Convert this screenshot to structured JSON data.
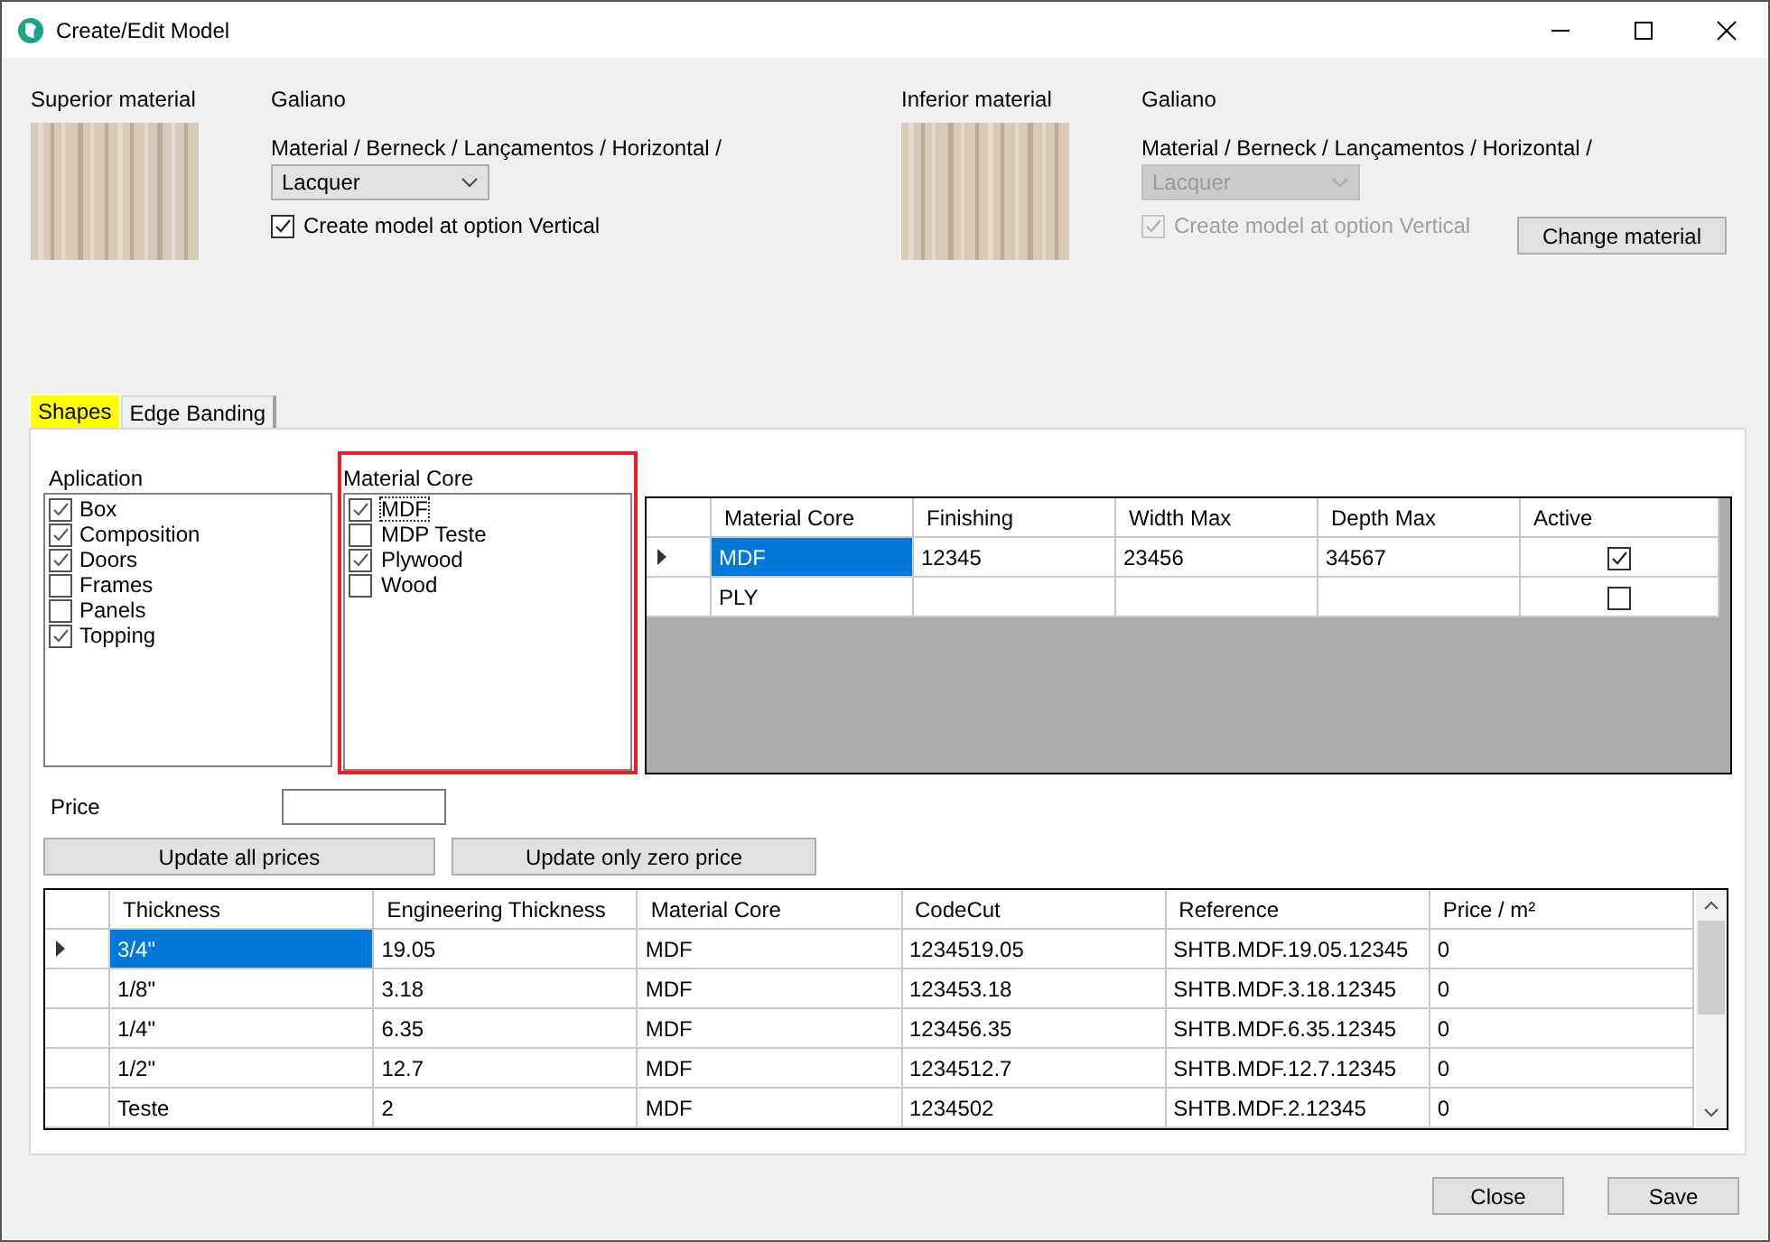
{
  "window": {
    "title": "Create/Edit Model"
  },
  "materials": [
    {
      "label": "Superior material",
      "name": "Galiano",
      "path": "Material / Berneck / Lançamentos / Horizontal /",
      "finish": {
        "value": "Lacquer",
        "disabled": false
      },
      "vertical": {
        "label": "Create model at option Vertical",
        "checked": true,
        "disabled": false
      }
    },
    {
      "label": "Inferior material",
      "name": "Galiano",
      "path": "Material / Berneck / Lançamentos / Horizontal /",
      "finish": {
        "value": "Lacquer",
        "disabled": true
      },
      "vertical": {
        "label": "Create model at option Vertical",
        "checked": true,
        "disabled": true
      }
    }
  ],
  "change_button": "Change material",
  "tabs": [
    {
      "label": "Shapes",
      "selected": true
    },
    {
      "label": "Edge Banding",
      "selected": false
    }
  ],
  "application": {
    "title": "Aplication",
    "items": [
      {
        "label": "Box",
        "checked": true
      },
      {
        "label": "Composition",
        "checked": true
      },
      {
        "label": "Doors",
        "checked": true
      },
      {
        "label": "Frames",
        "checked": false
      },
      {
        "label": "Panels",
        "checked": false
      },
      {
        "label": "Topping",
        "checked": true
      }
    ]
  },
  "material_core": {
    "title": "Material Core",
    "highlighted": true,
    "items": [
      {
        "label": "MDF",
        "checked": true,
        "focused": true
      },
      {
        "label": "MDP Teste",
        "checked": false,
        "focused": false
      },
      {
        "label": "Plywood",
        "checked": true,
        "focused": false
      },
      {
        "label": "Wood",
        "checked": false,
        "focused": false
      }
    ]
  },
  "core_grid": {
    "columns": [
      "Material Core",
      "Finishing",
      "Width Max",
      "Depth Max",
      "Active"
    ],
    "rows": [
      {
        "selected": true,
        "cells": [
          "MDF",
          "12345",
          "23456",
          "34567"
        ],
        "active": true
      },
      {
        "selected": false,
        "cells": [
          "PLY"
        ],
        "active": false
      }
    ]
  },
  "price": {
    "label": "Price"
  },
  "update_buttons": [
    "Update all prices",
    "Update only zero price"
  ],
  "thickness_grid": {
    "columns": [
      "Thickness",
      "Engineering Thickness",
      "Material Core",
      "CodeCut",
      "Reference",
      "Price / m²"
    ],
    "rows": [
      {
        "selected": true,
        "cells": [
          "3/4\"",
          "19.05",
          "MDF",
          "1234519.05",
          "SHTB.MDF.19.05.12345",
          "0"
        ]
      },
      {
        "selected": false,
        "cells": [
          "1/8\"",
          "3.18",
          "MDF",
          "123453.18",
          "SHTB.MDF.3.18.12345",
          "0"
        ]
      },
      {
        "selected": false,
        "cells": [
          "1/4\"",
          "6.35",
          "MDF",
          "123456.35",
          "SHTB.MDF.6.35.12345",
          "0"
        ]
      },
      {
        "selected": false,
        "cells": [
          "1/2\"",
          "12.7",
          "MDF",
          "1234512.7",
          "SHTB.MDF.12.7.12345",
          "0"
        ]
      },
      {
        "selected": false,
        "cells": [
          "Teste",
          "2",
          "MDF",
          "1234502",
          "SHTB.MDF.2.12345",
          "0"
        ]
      }
    ]
  },
  "buttons": [
    "Close",
    "Save"
  ]
}
